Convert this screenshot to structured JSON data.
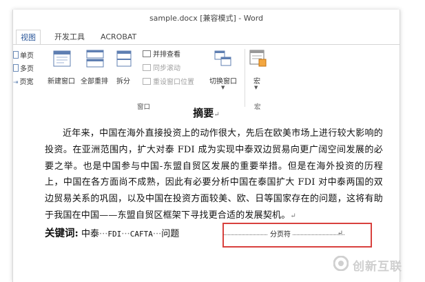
{
  "window": {
    "title": "sample.docx [兼容模式] - Word"
  },
  "tabs": [
    "视图",
    "开发工具",
    "ACROBAT"
  ],
  "ribbon": {
    "views": [
      "单页",
      "多页",
      "页宽"
    ],
    "new_window": "新建窗口",
    "arrange_all": "全部重排",
    "split": "拆分",
    "side_by_side": "并排查看",
    "sync_scroll": "同步滚动",
    "reset_position": "重设窗口位置",
    "switch_windows": "切换窗口",
    "window_group": "窗口",
    "macros": "宏",
    "macros_group": "宏"
  },
  "document": {
    "heading": "摘要",
    "paragraph": "近年来，中国在海外直接投资上的动作很大，先后在欧美市场上进行较大影响的投资。在亚洲范围内，扩大对泰 FDI 成为实现中泰双边贸易向更广阔空间发展的必要之举。也是中国参与中国-东盟自贸区发展的重要举措。但是在海外投资的历程上，中国在各方面尚不成熟，因此有必要分析中国在泰国扩大 FDI 对中泰两国的双边贸易关系的巩固，以及中国在投资方面较美、欧、日等国家存在的问题，这将有助于我国在中国——东盟自贸区框架下寻找更合适的发展契机。",
    "keywords_label": "关键词:",
    "kw1": "中泰",
    "kw2": "FDI",
    "kw3": "CAFTA",
    "kw4": "问题",
    "kw_sep": "···",
    "para_mark": "↵",
    "page_break": "分页符"
  },
  "watermark": {
    "text": "创新互联"
  },
  "colors": {
    "accent": "#2b579a",
    "highlight": "#d8403d"
  }
}
